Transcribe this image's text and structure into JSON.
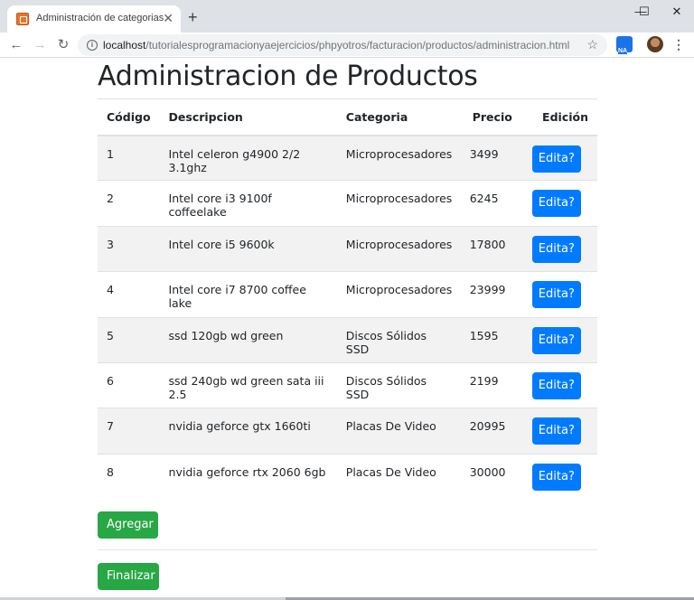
{
  "browser": {
    "tab_title": "Administración de categorias",
    "tab_close": "✕",
    "new_tab": "+",
    "window_minimize": "—",
    "window_maximize": "☐",
    "window_close": "✕",
    "back": "←",
    "forward": "→",
    "reload": "↻",
    "url_host": "localhost",
    "url_path": "/tutorialesprogramacionyaejercicios/phpyotros/facturacion/productos/administracion.html",
    "star": "☆",
    "menu": "⋮"
  },
  "page": {
    "title": "Administracion de Productos",
    "table": {
      "headers": {
        "code": "Código",
        "description": "Descripcion",
        "category": "Categoria",
        "price": "Precio",
        "edit": "Edición"
      },
      "rows": [
        {
          "code": "1",
          "description": "Intel celeron g4900 2/2 3.1ghz",
          "category": "Microprocesadores",
          "price": "3499",
          "edit_label": "Edita?"
        },
        {
          "code": "2",
          "description": "Intel core i3 9100f coffeelake",
          "category": "Microprocesadores",
          "price": "6245",
          "edit_label": "Edita?"
        },
        {
          "code": "3",
          "description": "Intel core i5 9600k",
          "category": "Microprocesadores",
          "price": "17800",
          "edit_label": "Edita?"
        },
        {
          "code": "4",
          "description": "Intel core i7 8700 coffee lake",
          "category": "Microprocesadores",
          "price": "23999",
          "edit_label": "Edita?"
        },
        {
          "code": "5",
          "description": "ssd 120gb wd green",
          "category": "Discos Sólidos SSD",
          "price": "1595",
          "edit_label": "Edita?"
        },
        {
          "code": "6",
          "description": "ssd 240gb wd green sata iii 2.5",
          "category": "Discos Sólidos SSD",
          "price": "2199",
          "edit_label": "Edita?"
        },
        {
          "code": "7",
          "description": "nvidia geforce gtx 1660ti",
          "category": "Placas De Video",
          "price": "20995",
          "edit_label": "Edita?"
        },
        {
          "code": "8",
          "description": "nvidia geforce rtx 2060 6gb",
          "category": "Placas De Video",
          "price": "30000",
          "edit_label": "Edita?"
        }
      ]
    },
    "add_button": "Agregar",
    "finish_button": "Finalizar"
  },
  "colors": {
    "primary": "#007bff",
    "success": "#28a745",
    "stripe": "#f2f2f2"
  }
}
